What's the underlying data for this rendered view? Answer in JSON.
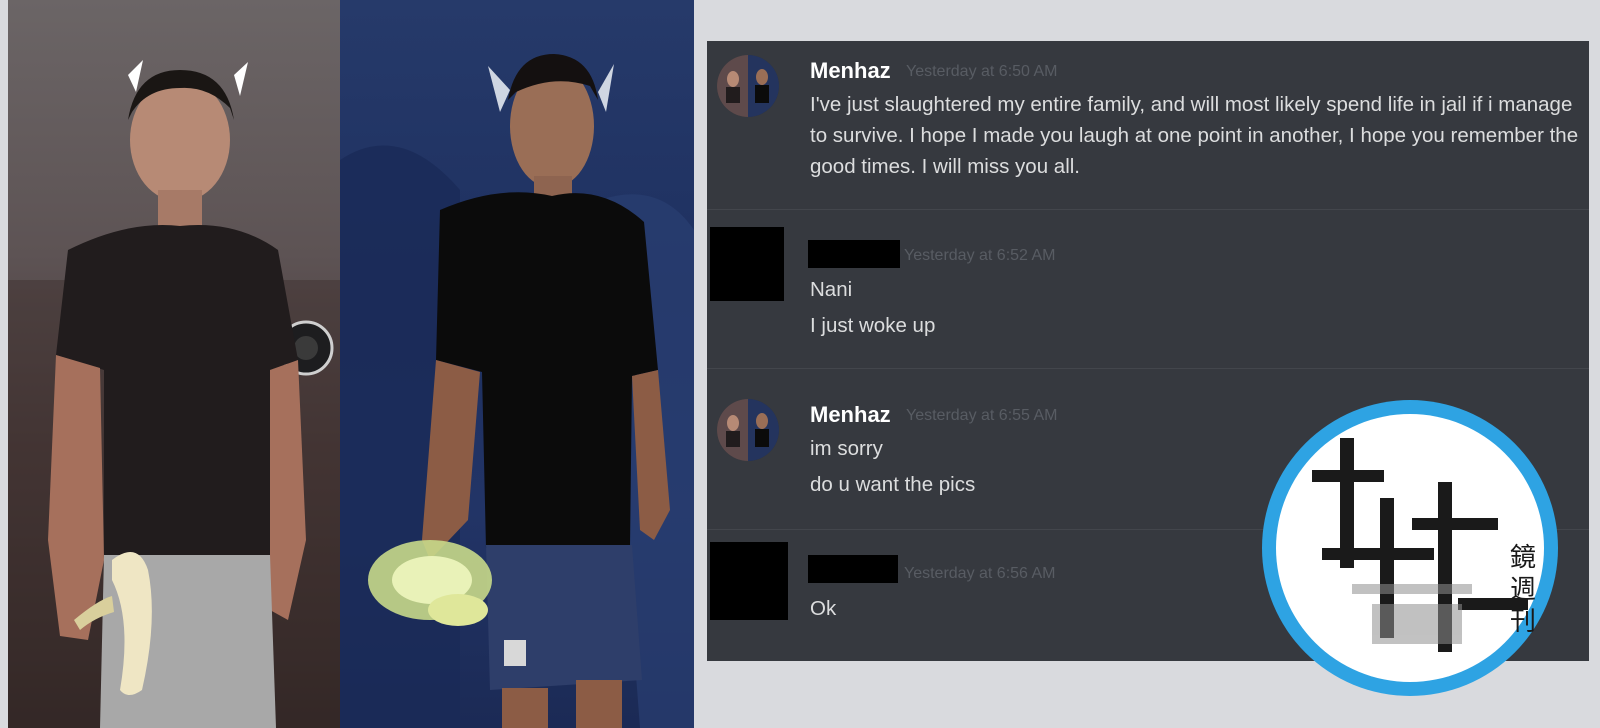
{
  "photos": {
    "left_photo": "photo-person-with-banana",
    "right_photo": "game-avatar-render"
  },
  "chat": {
    "messages": [
      {
        "author": "Menhaz",
        "timestamp": "Yesterday at 6:50 AM",
        "text": "I've just slaughtered my entire family, and will most likely spend life in jail if i manage to survive. I hope I made you laugh at one point in another, I hope you remember the good times. I will miss you all."
      },
      {
        "author": "",
        "author_redacted": true,
        "timestamp": "Yesterday at 6:52 AM",
        "lines": [
          "Nani",
          "I just woke up"
        ]
      },
      {
        "author": "Menhaz",
        "timestamp": "Yesterday at 6:55 AM",
        "lines": [
          "im sorry",
          "do u want the pics"
        ]
      },
      {
        "author": "",
        "author_redacted": true,
        "timestamp": "Yesterday at 6:56 AM",
        "lines": [
          "Ok"
        ]
      }
    ]
  },
  "watermark": {
    "logo": "mirror-media-weekly-logo",
    "text": "鏡週刊",
    "colors": {
      "ring": "#2ea3e3",
      "inner": "#ffffff",
      "mark": "#1a1a1a"
    }
  }
}
